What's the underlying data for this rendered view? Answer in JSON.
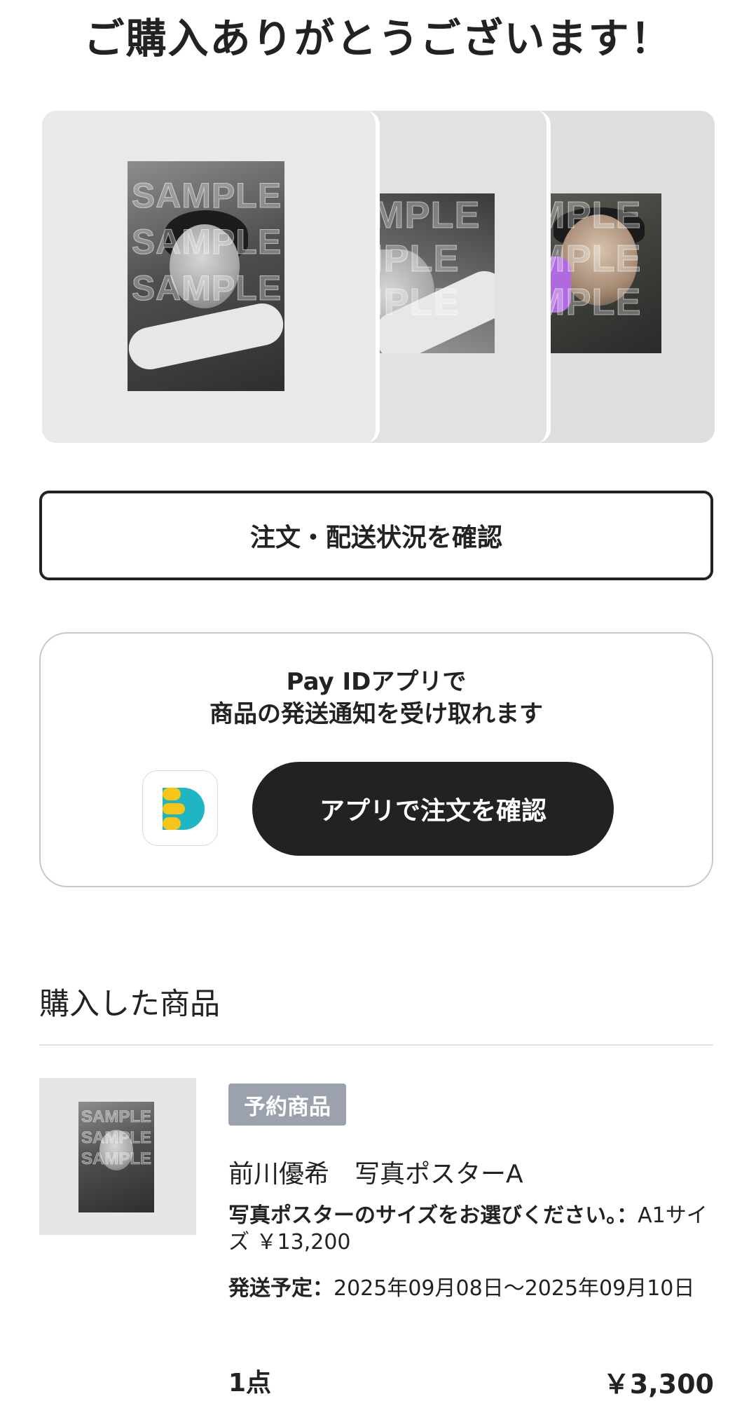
{
  "page_title": "ご購入ありがとうございます！",
  "gallery": {
    "watermark": "SAMPLE",
    "cards": [
      "photo-1",
      "photo-2",
      "photo-3"
    ]
  },
  "order_status_button": "注文・配送状況を確認",
  "app_promo": {
    "line1": "Pay IDアプリで",
    "line2": "商品の発送通知を受け取れます",
    "icon": "pay-id-app-icon",
    "button_label": "アプリで注文を確認"
  },
  "purchased": {
    "section_title": "購入した商品",
    "item": {
      "badge": "予約商品",
      "name": "前川優希　写真ポスターA",
      "option_label": "写真ポスターのサイズをお選びください。：",
      "option_value": "A1サイズ ￥13,200",
      "ship_label": "発送予定：",
      "ship_value": "2025年09月08日〜2025年09月10日",
      "quantity": "1点",
      "price": "￥3,300"
    }
  },
  "colors": {
    "text": "#222222",
    "badge_bg": "#9ba1ad",
    "app_brand_yellow": "#f5c518",
    "app_brand_teal": "#1fb5c4"
  }
}
